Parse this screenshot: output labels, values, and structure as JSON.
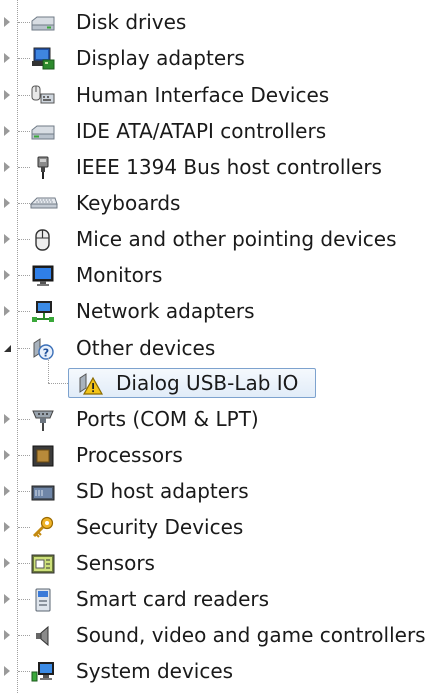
{
  "device_tree": {
    "items": [
      {
        "label": "Disk drives",
        "icon": "disk-drive-icon",
        "expanded": false
      },
      {
        "label": "Display adapters",
        "icon": "display-adapter-icon",
        "expanded": false
      },
      {
        "label": "Human Interface Devices",
        "icon": "hid-icon",
        "expanded": false
      },
      {
        "label": "IDE ATA/ATAPI controllers",
        "icon": "ide-controller-icon",
        "expanded": false
      },
      {
        "label": "IEEE 1394 Bus host controllers",
        "icon": "firewire-icon",
        "expanded": false
      },
      {
        "label": "Keyboards",
        "icon": "keyboard-icon",
        "expanded": false
      },
      {
        "label": "Mice and other pointing devices",
        "icon": "mouse-icon",
        "expanded": false
      },
      {
        "label": "Monitors",
        "icon": "monitor-icon",
        "expanded": false
      },
      {
        "label": "Network adapters",
        "icon": "network-adapter-icon",
        "expanded": false
      },
      {
        "label": "Other devices",
        "icon": "unknown-device-icon",
        "expanded": true,
        "children": [
          {
            "label": "Dialog USB-Lab IO",
            "icon": "warning-device-icon",
            "selected": true
          }
        ]
      },
      {
        "label": "Ports (COM & LPT)",
        "icon": "port-icon",
        "expanded": false
      },
      {
        "label": "Processors",
        "icon": "processor-icon",
        "expanded": false
      },
      {
        "label": "SD host adapters",
        "icon": "sd-host-icon",
        "expanded": false
      },
      {
        "label": "Security Devices",
        "icon": "security-key-icon",
        "expanded": false
      },
      {
        "label": "Sensors",
        "icon": "sensor-icon",
        "expanded": false
      },
      {
        "label": "Smart card readers",
        "icon": "smart-card-icon",
        "expanded": false
      },
      {
        "label": "Sound, video and game controllers",
        "icon": "speaker-icon",
        "expanded": false
      },
      {
        "label": "System devices",
        "icon": "system-device-icon",
        "expanded": false
      }
    ]
  },
  "colors": {
    "selection_border": "#7da2ce",
    "selection_fill": "#e1ecf8",
    "warning_yellow": "#f3c419"
  }
}
